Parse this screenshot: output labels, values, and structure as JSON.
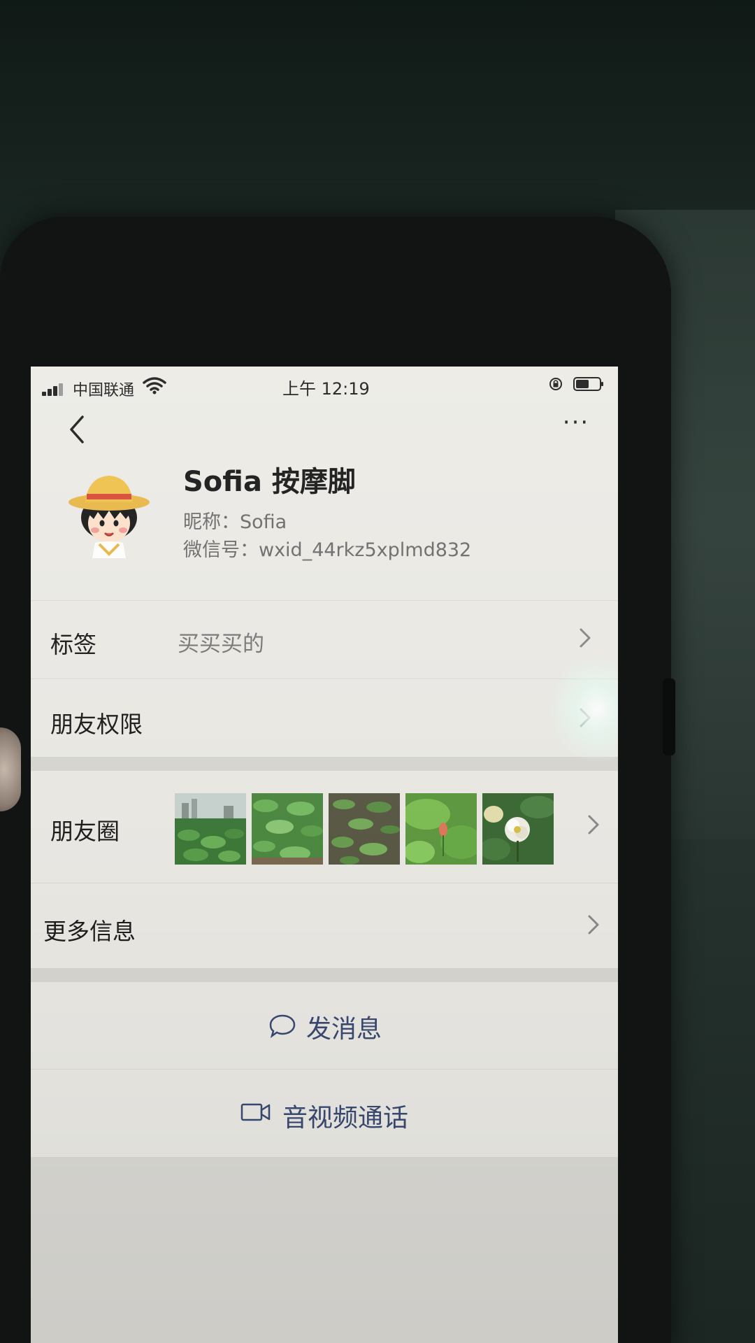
{
  "status_bar": {
    "carrier": "中国联通",
    "time": "上午 12:19"
  },
  "nav": {
    "back_icon": "chevron-left-icon",
    "more_icon": "more-dots-icon",
    "more_text": "···"
  },
  "profile": {
    "name": "Sofia 按摩脚",
    "nickname": "昵称：Sofia",
    "wechat_id": "微信号：wxid_44rkz5xplmd832"
  },
  "rows": {
    "tags_label": "标签",
    "tags_value": "买买买的",
    "permissions_label": "朋友权限",
    "moments_label": "朋友圈",
    "more_info_label": "更多信息"
  },
  "actions": {
    "message_label": "发消息",
    "video_call_label": "音视频通话"
  },
  "colors": {
    "action_text": "#3a4a72",
    "screen_bg": "#ecebe6",
    "separator": "#d9d8d3"
  }
}
